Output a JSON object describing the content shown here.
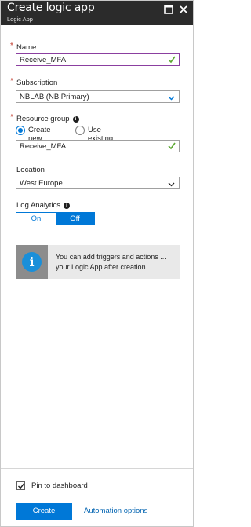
{
  "header": {
    "title": "Create logic app",
    "subtitle": "Logic App",
    "icons": [
      "maximize-icon",
      "close-icon"
    ]
  },
  "form": {
    "name": {
      "label": "Name",
      "value": "Receive_MFA",
      "required": true,
      "valid": true
    },
    "subscription": {
      "label": "Subscription",
      "value": "NBLAB (NB Primary)",
      "required": true
    },
    "resource_group": {
      "label": "Resource group",
      "required": true,
      "options": [
        "Create new",
        "Use existing"
      ],
      "selected": "Create new",
      "value": "Receive_MFA",
      "valid": true
    },
    "location": {
      "label": "Location",
      "value": "West Europe"
    },
    "log_analytics": {
      "label": "Log Analytics",
      "on_label": "On",
      "off_label": "Off",
      "selected": "Off"
    }
  },
  "info": {
    "line1": "You can add triggers and actions ...",
    "line2": "your Logic App after creation."
  },
  "footer": {
    "pin_label": "Pin to dashboard",
    "pin_checked": true,
    "create_label": "Create",
    "automation_label": "Automation options"
  },
  "colors": {
    "header_bg": "#2b2b2b",
    "accent": "#0078d7",
    "valid_check": "#5ca832",
    "required_star": "#c0392b"
  }
}
